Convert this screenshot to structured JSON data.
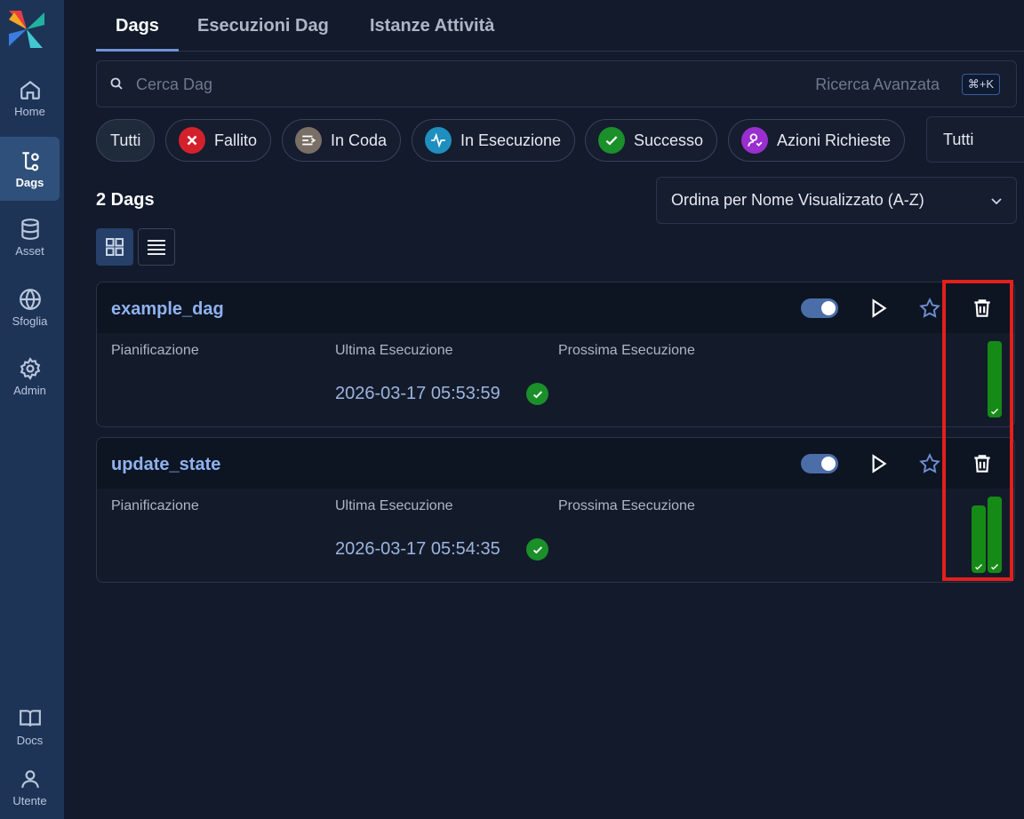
{
  "sidebar": {
    "items": [
      {
        "label": "Home",
        "icon": "home-icon"
      },
      {
        "label": "Dags",
        "icon": "dags-icon"
      },
      {
        "label": "Asset",
        "icon": "database-icon"
      },
      {
        "label": "Sfoglia",
        "icon": "globe-icon"
      },
      {
        "label": "Admin",
        "icon": "gear-icon"
      },
      {
        "label": "Docs",
        "icon": "book-icon"
      },
      {
        "label": "Utente",
        "icon": "user-icon"
      }
    ],
    "active": "Dags"
  },
  "tabs": [
    {
      "label": "Dags",
      "active": true
    },
    {
      "label": "Esecuzioni Dag",
      "active": false
    },
    {
      "label": "Istanze Attività",
      "active": false
    }
  ],
  "search": {
    "placeholder": "Cerca Dag",
    "value": "",
    "advanced_label": "Ricerca Avanzata",
    "shortcut": "⌘+K"
  },
  "filters": {
    "chips": [
      {
        "label": "Tutti",
        "selected": true
      },
      {
        "label": "Fallito",
        "color": "#d3212c",
        "icon": "x-icon"
      },
      {
        "label": "In Coda",
        "color": "#7a6f66",
        "icon": "queue-icon"
      },
      {
        "label": "In Esecuzione",
        "color": "#1f8fbf",
        "icon": "pulse-icon"
      },
      {
        "label": "Successo",
        "color": "#1a8f2a",
        "icon": "check-icon"
      },
      {
        "label": "Azioni Richieste",
        "color": "#9a2ecf",
        "icon": "user-action-icon"
      }
    ],
    "tag_select": "Tutti"
  },
  "list": {
    "count_label": "2 Dags",
    "sort_label": "Ordina per Nome Visualizzato (A-Z)",
    "view_mode": "card"
  },
  "dags": [
    {
      "name": "example_dag",
      "enabled": true,
      "schedule_label": "Pianificazione",
      "last_run_label": "Ultima Esecuzione",
      "next_run_label": "Prossima Esecuzione",
      "last_run": "2026-03-17 05:53:59",
      "last_run_state": "success",
      "recent_runs": [
        {
          "state": "success",
          "duration_fraction": 1.0
        }
      ]
    },
    {
      "name": "update_state",
      "enabled": true,
      "schedule_label": "Pianificazione",
      "last_run_label": "Ultima Esecuzione",
      "next_run_label": "Prossima Esecuzione",
      "last_run": "2026-03-17 05:54:35",
      "last_run_state": "success",
      "recent_runs": [
        {
          "state": "success",
          "duration_fraction": 0.88
        },
        {
          "state": "success",
          "duration_fraction": 1.0
        }
      ]
    }
  ],
  "colors": {
    "success": "#168a16",
    "highlight": "#e3201b",
    "accent": "#8fb2ef"
  }
}
